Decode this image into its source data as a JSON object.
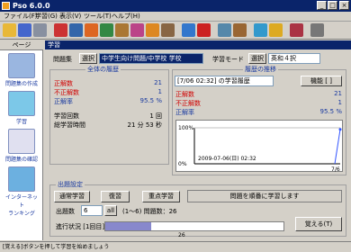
{
  "window": {
    "title": "Pso 6.0.0",
    "min": "_",
    "max": "□",
    "close": "×"
  },
  "menu": [
    "ファイル(F)",
    "学習(G)",
    "表示(V)",
    "ツール(T)",
    "ヘルプ(H)"
  ],
  "toolbar": {
    "icons": [
      "folder-icon",
      "save-icon",
      "print-icon",
      "book-icon",
      "list-icon",
      "bookmark-icon",
      "notebook-icon",
      "pencil-icon",
      "dictionary-icon",
      "bird-icon",
      "char-icon",
      "arrow-icon",
      "flag-icon",
      "gear-icon",
      "users-icon",
      "chart-icon",
      "help-icon",
      "book2-icon",
      "exit-icon"
    ]
  },
  "sidebar": {
    "header": "ページ",
    "items": [
      {
        "label": "問題集の作成",
        "icon": "book-stack-icon"
      },
      {
        "label": "学習",
        "icon": "cat-icon"
      },
      {
        "label": "問題集の確認",
        "icon": "person-icon"
      },
      {
        "label": "インターネット\nランキング",
        "icon": "globe-icon"
      }
    ]
  },
  "main": {
    "panel_title": "学習",
    "set_label": "問題集",
    "set_select_btn": "選択",
    "set_value": "中学生向け問題/中学校 学校",
    "mode_label": "学習モード",
    "mode_select_btn": "選択",
    "mode_value": "英和４択",
    "overall": {
      "title": "全体の履歴",
      "correct_label": "正解数",
      "correct": "21",
      "wrong_label": "不正解数",
      "wrong": "1",
      "rate_label": "正解率",
      "rate": "95.5 %",
      "count_label": "学習回数",
      "count": "1 回",
      "time_label": "総学習時間",
      "time": "21 分 53 秒"
    },
    "history": {
      "title": "履歴の推移",
      "select": "[7/06 02:32] の学習履歴",
      "button": "機能 [ ]",
      "correct_label": "正解数",
      "correct": "21",
      "wrong_label": "不正解数",
      "wrong": "1",
      "rate_label": "正解率",
      "rate": "95.5 %",
      "y_top": "100%",
      "y_bottom": "0%",
      "stamp": "2009-07-06(日) 02:32",
      "x_right": "7/6"
    },
    "settings": {
      "title": "出題設定",
      "btn_normal": "通常学習",
      "btn_review": "復習",
      "btn_focus": "重点学習",
      "order_text": "問題を順番に学習します",
      "count_label": "出題数",
      "count_value": "6",
      "all_btn": "all",
      "range_text": "(1〜6) 問題数：26",
      "progress_label": "進行状況 [1回目]",
      "progress_pct": "26",
      "progress_fraction": 0.26,
      "memorize_btn": "覚える(T)"
    }
  },
  "statusbar": {
    "text": "[覚える]ボタンを押して学習を始めましょう"
  },
  "chart_data": {
    "type": "line",
    "x": [
      "7/06 02:32"
    ],
    "y": [
      95.5
    ],
    "ylim": [
      0,
      100
    ]
  }
}
